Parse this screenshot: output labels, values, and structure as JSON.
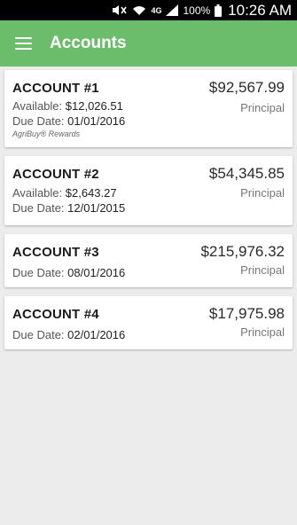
{
  "status_bar": {
    "battery_percent": "100%",
    "time": "10:26 AM",
    "network": "4G"
  },
  "app_bar": {
    "title": "Accounts"
  },
  "accounts": [
    {
      "name": "ACCOUNT #1",
      "amount": "$92,567.99",
      "type": "Principal",
      "available_label": "Available:",
      "available_value": "$12,026.51",
      "due_label": "Due Date:",
      "due_value": "01/01/2016",
      "note": "AgriBuy® Rewards"
    },
    {
      "name": "ACCOUNT #2",
      "amount": "$54,345.85",
      "type": "Principal",
      "available_label": "Available:",
      "available_value": "$2,643.27",
      "due_label": "Due Date:",
      "due_value": "12/01/2015"
    },
    {
      "name": "ACCOUNT #3",
      "amount": "$215,976.32",
      "type": "Principal",
      "due_label": "Due Date:",
      "due_value": "08/01/2016"
    },
    {
      "name": "ACCOUNT #4",
      "amount": "$17,975.98",
      "type": "Principal",
      "due_label": "Due Date:",
      "due_value": "02/01/2016"
    }
  ]
}
